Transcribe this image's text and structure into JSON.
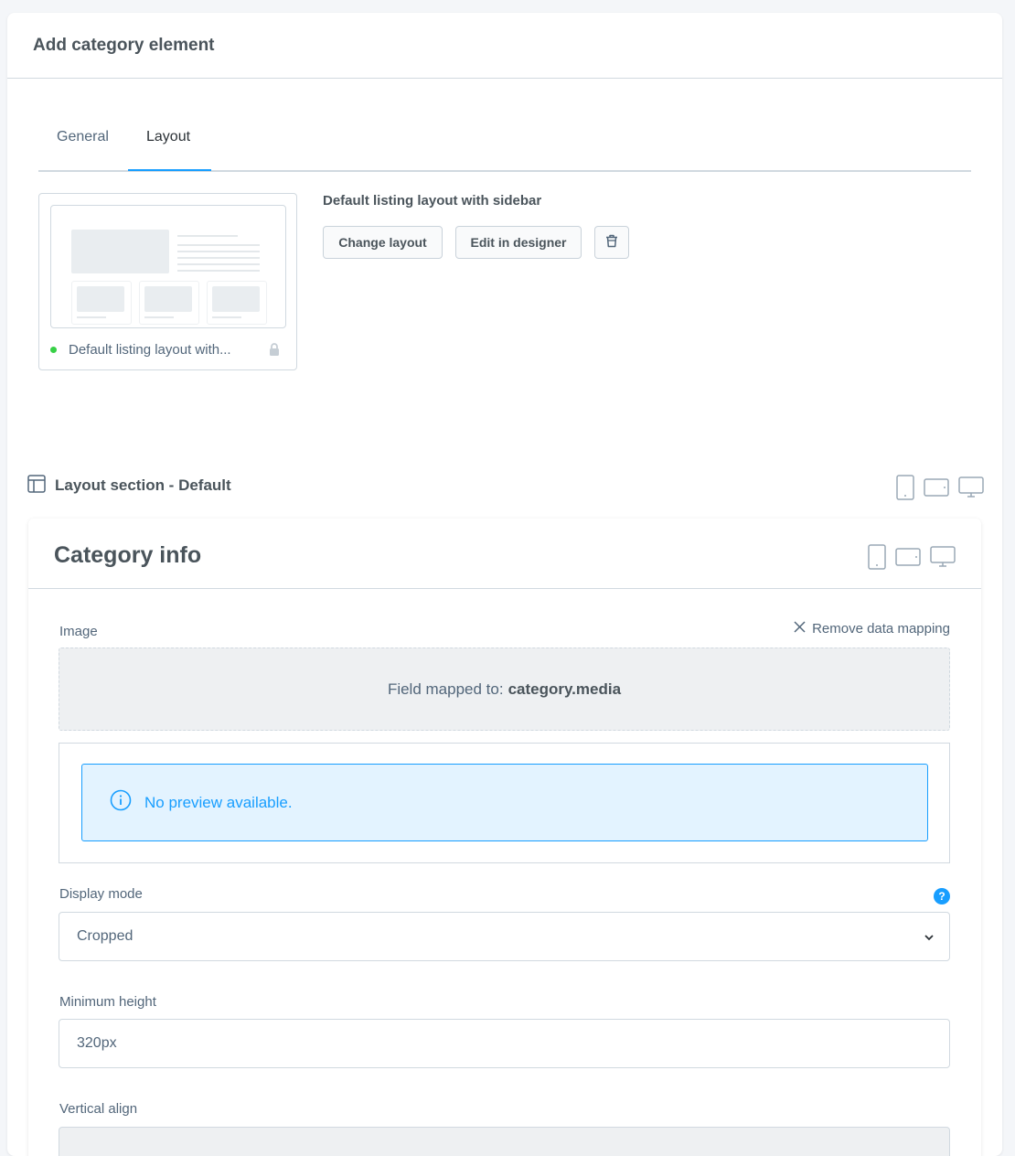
{
  "header": {
    "title": "Add category element"
  },
  "tabs": [
    {
      "label": "General"
    },
    {
      "label": "Layout"
    }
  ],
  "layout": {
    "card_label": "Default listing layout with...",
    "name": "Default listing layout with sidebar",
    "change_label": "Change layout",
    "edit_label": "Edit in designer"
  },
  "section": {
    "title": "Layout section - Default"
  },
  "block": {
    "title": "Category info",
    "image_label": "Image",
    "remove_mapping_label": "Remove data mapping",
    "mapped_prefix": "Field mapped to:",
    "mapped_field": "category.media",
    "no_preview": "No preview available.",
    "display_mode_label": "Display mode",
    "display_mode_value": "Cropped",
    "min_height_label": "Minimum height",
    "min_height_value": "320px",
    "vertical_align_label": "Vertical align"
  },
  "colors": {
    "accent": "#189eff",
    "status_active": "#37d046",
    "alert_bg": "#e3f3ff"
  }
}
